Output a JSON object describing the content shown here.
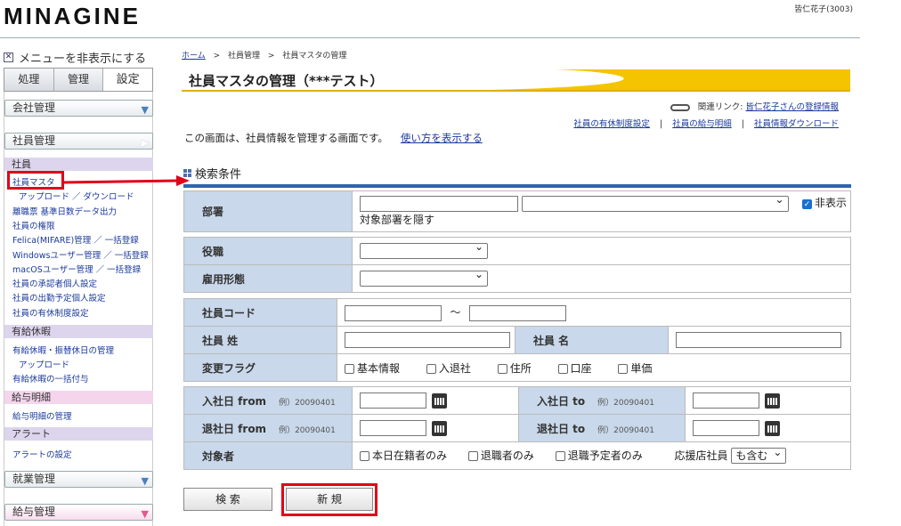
{
  "header": {
    "logo": "MINAGINE",
    "user": "皆仁花子(3003)"
  },
  "menu_toggle": "メニューを非表示にする",
  "tabs": [
    "処理",
    "管理",
    "設定"
  ],
  "sidebar": {
    "company": "会社管理",
    "employee_mgmt": "社員管理",
    "sec_employee": "社員",
    "links_employee": [
      "社員マスタ",
      "アップロード ／ ダウンロード",
      "離職票 基準日数データ出力",
      "社員の権限",
      "Felica(MIFARE)管理 ／ 一括登録",
      "Windowsユーザー管理 ／ 一括登録",
      "macOSユーザー管理 ／ 一括登録",
      "社員の承認者個人設定",
      "社員の出勤予定個人設定",
      "社員の有休制度設定"
    ],
    "sec_leave": "有給休暇",
    "links_leave": [
      "有給休暇・振替休日の管理",
      "アップロード",
      "有給休暇の一括付与"
    ],
    "sec_pay": "給与明細",
    "links_pay": [
      "給与明細の管理"
    ],
    "sec_alert": "アラート",
    "links_alert": [
      "アラートの設定"
    ],
    "work": "就業管理",
    "payroll": "給与管理"
  },
  "breadcrumb": {
    "home": "ホーム",
    "sep1": ">",
    "mid": "社員管理",
    "sep2": ">",
    "current": "社員マスタの管理"
  },
  "page_title": "社員マスタの管理（***テスト）",
  "related": {
    "label": "関連リンク:",
    "link": "皆仁花子さんの登録情報",
    "links": [
      "社員の有休制度設定",
      "社員の給与明細",
      "社員情報ダウンロード"
    ],
    "sep": "|"
  },
  "description": "この画面は、社員情報を管理する画面です。",
  "howto": "使い方を表示する",
  "search": {
    "heading": "検索条件",
    "dept": "部署",
    "dept_hide": "非表示対象部署を隠す",
    "position": "役職",
    "employment": "雇用形態",
    "code": "社員コード",
    "tilde": "〜",
    "last_name": "社員 姓",
    "first_name": "社員 名",
    "change_flag": "変更フラグ",
    "flags": [
      "基本情報",
      "入退社",
      "住所",
      "口座",
      "単価"
    ],
    "join_from": "入社日 from",
    "join_to": "入社日 to",
    "leave_from": "退社日 from",
    "leave_to": "退社日 to",
    "example": "例）20090401",
    "target": "対象者",
    "targets": [
      "本日在籍者のみ",
      "退職者のみ",
      "退職予定者のみ"
    ],
    "support": "応援店社員",
    "support_value": "も含む"
  },
  "buttons": {
    "search": "検 索",
    "new": "新 規"
  }
}
